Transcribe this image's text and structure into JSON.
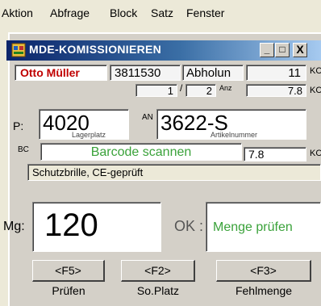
{
  "menu": {
    "items": [
      "Aktion",
      "Abfrage",
      "Block",
      "Satz",
      "Fenster"
    ]
  },
  "window": {
    "title": "MDE-KOMISSIONIEREN",
    "buttons": {
      "minimize": "_",
      "restore": "□",
      "close": "X"
    }
  },
  "header": {
    "user": "Otto Müller",
    "order_no": "3811530",
    "status": "Abholun",
    "count": "11",
    "unit1": "KC",
    "pos_current": "1",
    "pos_separator": "/",
    "pos_total": "2",
    "anz_label": "Anz",
    "anz_value": "7.8",
    "unit2": "KC"
  },
  "place": {
    "p_label": "P:",
    "place_value": "4020",
    "place_sublabel": "Lagerplatz",
    "an_label": "AN",
    "article_value": "3622-S",
    "article_sublabel": "Artikelnummer"
  },
  "barcode": {
    "bc_label": "BC",
    "prompt": "Barcode scannen",
    "qty": "7.8",
    "unit": "KC",
    "description": "Schutzbrille, CE-geprüft"
  },
  "quantity": {
    "mg_label": "Mg:",
    "mg_value": "120",
    "ok_label": "OK :",
    "ok_prompt": "Menge prüfen"
  },
  "fkeys": [
    {
      "key": "<F5>",
      "caption": "Prüfen"
    },
    {
      "key": "<F2>",
      "caption": "So.Platz"
    },
    {
      "key": "<F3>",
      "caption": "Fehlmenge"
    }
  ],
  "colors": {
    "user_text": "#c00000",
    "prompt_green": "#3aa23a",
    "title_blue": "#0a246a"
  }
}
